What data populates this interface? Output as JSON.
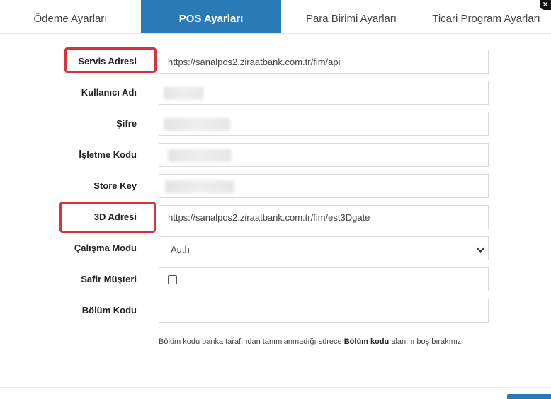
{
  "tabs": [
    {
      "label": "Ödeme Ayarları",
      "active": false
    },
    {
      "label": "POS Ayarları",
      "active": true
    },
    {
      "label": "Para Birimi Ayarları",
      "active": false
    },
    {
      "label": "Ticari Program Ayarları",
      "active": false
    }
  ],
  "close_icon": "×",
  "form": {
    "servis_adresi": {
      "label": "Servis Adresi",
      "value": "https://sanalpos2.ziraatbank.com.tr/fim/api"
    },
    "kullanici_adi": {
      "label": "Kullanıcı Adı"
    },
    "sifre": {
      "label": "Şifre"
    },
    "isletme_kodu": {
      "label": "İşletme Kodu"
    },
    "store_key": {
      "label": "Store Key"
    },
    "uc_d_adresi": {
      "label": "3D Adresi",
      "value": "https://sanalpos2.ziraatbank.com.tr/fim/est3Dgate"
    },
    "calisma_modu": {
      "label": "Çalışma Modu",
      "value": "Auth"
    },
    "safir_musteri": {
      "label": "Safir Müşteri",
      "checked": false
    },
    "bolum_kodu": {
      "label": "Bölüm Kodu",
      "value": ""
    }
  },
  "hint": {
    "before": "Bölüm kodu banka tarafından tanımlanmadığı sürece ",
    "bold": "Bölüm kodu",
    "after": " alanını boş bırakınız"
  },
  "colors": {
    "accent": "#2a7ab8",
    "highlight": "#d9343a"
  }
}
